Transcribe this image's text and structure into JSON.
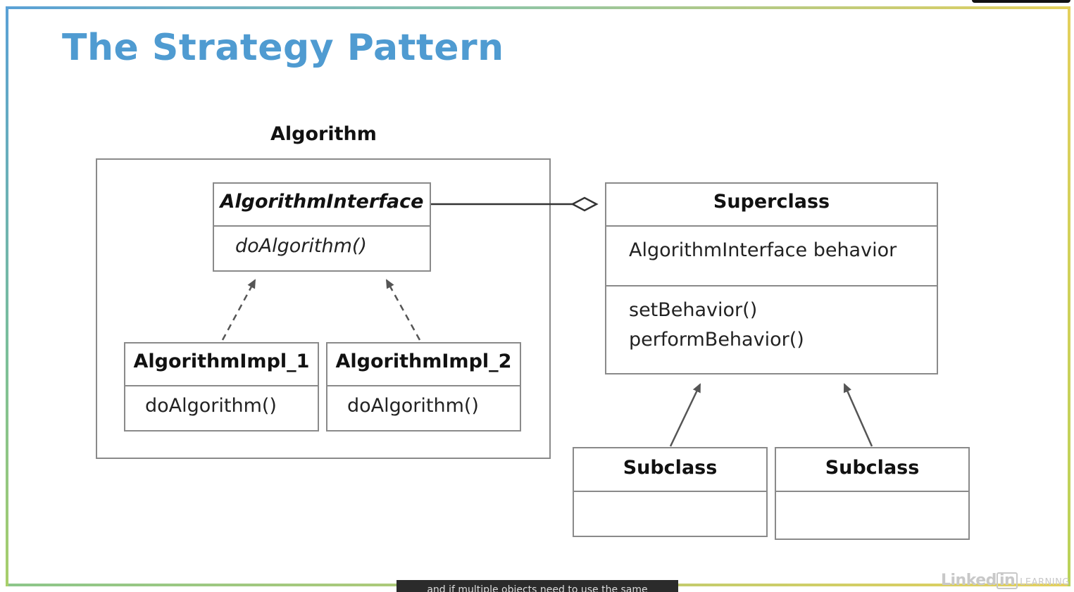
{
  "slide": {
    "title": "The Strategy Pattern"
  },
  "algorithm_group": {
    "label": "Algorithm",
    "interface": {
      "name": "AlgorithmInterface",
      "methods": [
        "doAlgorithm()"
      ]
    },
    "impl_1": {
      "name": "AlgorithmImpl_1",
      "methods": [
        "doAlgorithm()"
      ]
    },
    "impl_2": {
      "name": "AlgorithmImpl_2",
      "methods": [
        "doAlgorithm()"
      ]
    }
  },
  "superclass": {
    "name": "Superclass",
    "attributes": [
      "AlgorithmInterface behavior"
    ],
    "methods": [
      "setBehavior()",
      "performBehavior()"
    ]
  },
  "subclasses": [
    {
      "name": "Subclass"
    },
    {
      "name": "Subclass"
    }
  ],
  "relationships": [
    {
      "from": "AlgorithmImpl_1",
      "to": "AlgorithmInterface",
      "type": "realization"
    },
    {
      "from": "AlgorithmImpl_2",
      "to": "AlgorithmInterface",
      "type": "realization"
    },
    {
      "from": "Superclass",
      "to": "AlgorithmInterface",
      "type": "aggregation"
    },
    {
      "from": "Subclass",
      "to": "Superclass",
      "type": "inheritance"
    },
    {
      "from": "Subclass",
      "to": "Superclass",
      "type": "inheritance"
    }
  ],
  "caption": {
    "text": "and if multiple objects need to use the same"
  },
  "branding": {
    "logo_main": "Linked",
    "logo_in": "in",
    "logo_sub": "LEARNING"
  },
  "colors": {
    "title": "#4f9bd1",
    "box_border": "#8a8a8a",
    "arrow": "#555555"
  }
}
